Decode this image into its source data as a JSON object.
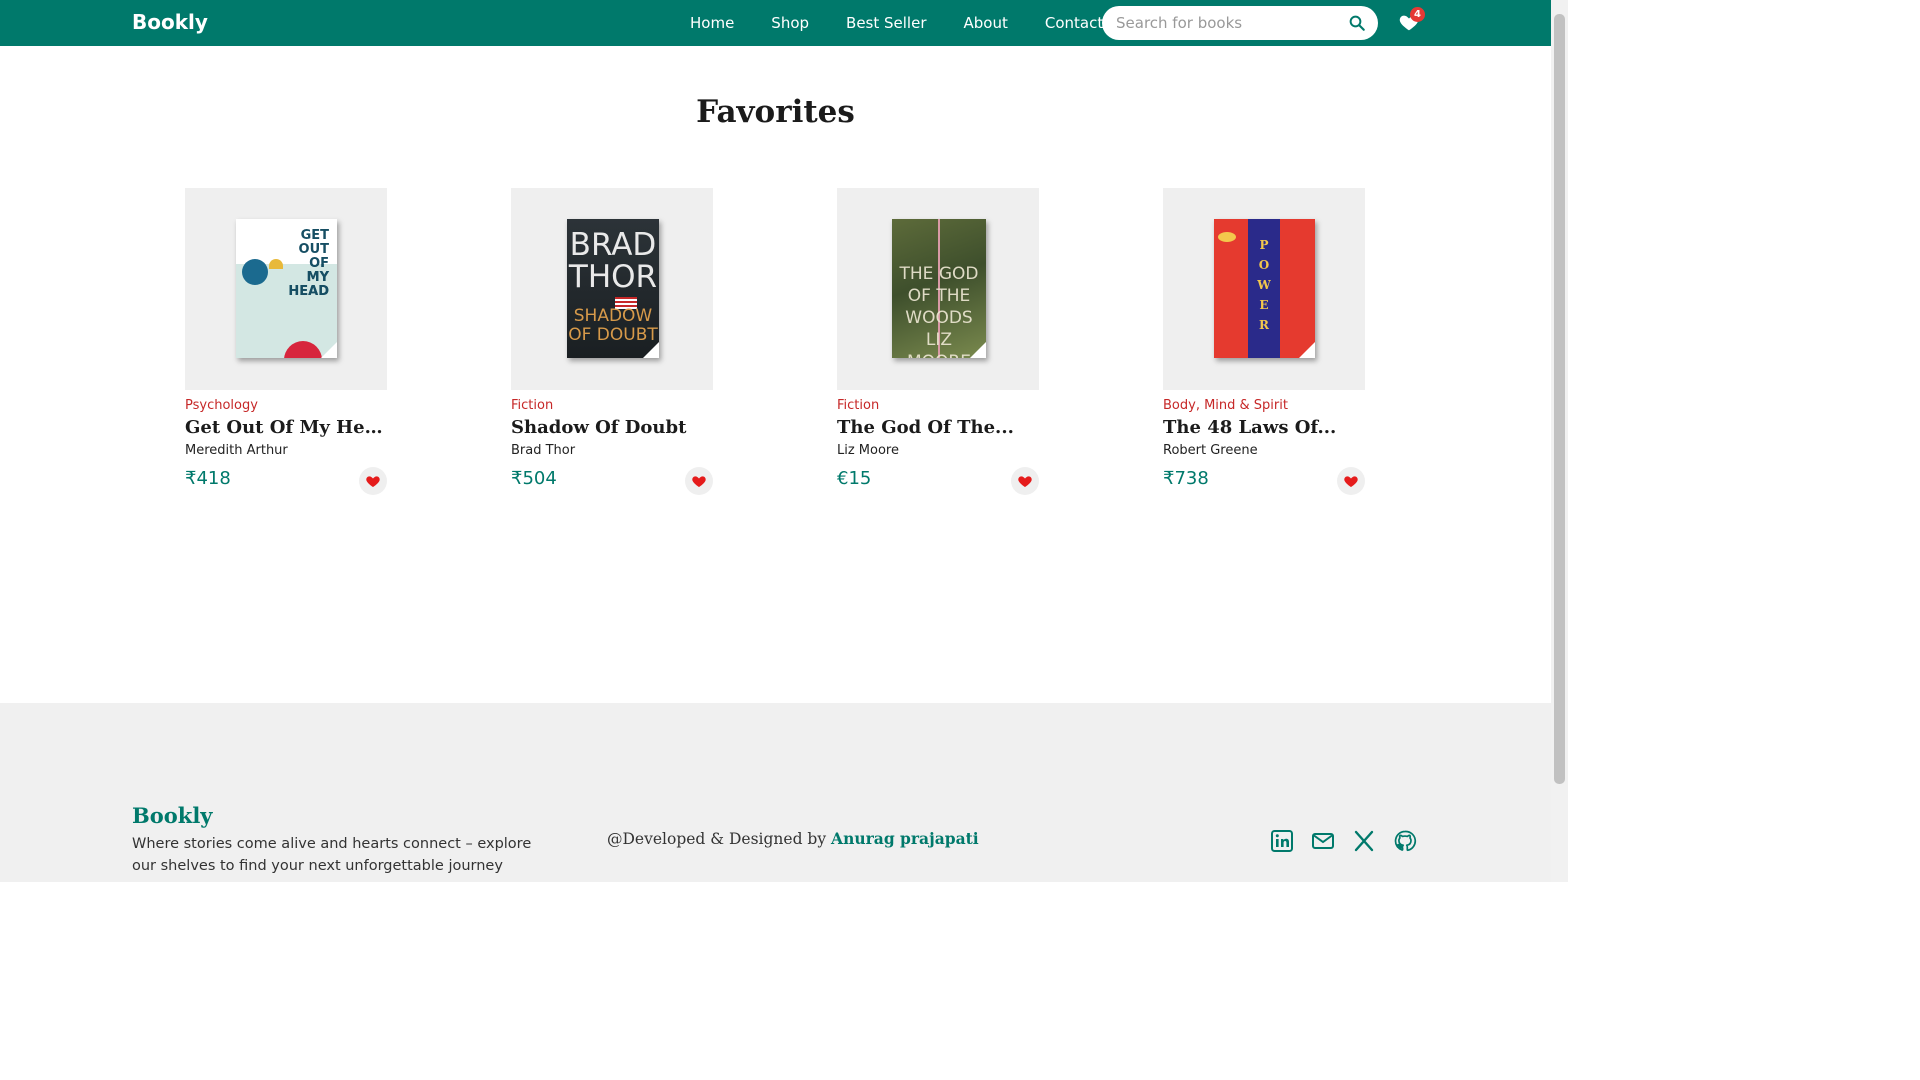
{
  "nav": {
    "brand": "Bookly",
    "links": [
      "Home",
      "Shop",
      "Best Seller",
      "About",
      "Contact"
    ],
    "search_placeholder": "Search for books",
    "favorites_count": "4"
  },
  "page": {
    "title": "Favorites"
  },
  "books": [
    {
      "category": "Psychology",
      "title": "Get Out Of My Head",
      "author": "Meredith Arthur",
      "price": "₹418",
      "cover_text": [
        "GET",
        "OUT",
        "OF",
        "MY",
        "HEAD"
      ]
    },
    {
      "category": "Fiction",
      "title": "Shadow Of Doubt",
      "author": "Brad Thor",
      "price": "₹504",
      "cover_text": [
        "BRAD",
        "THOR",
        "SHADOW",
        "OF DOUBT"
      ]
    },
    {
      "category": "Fiction",
      "title": "The God Of The...",
      "author": "Liz Moore",
      "price": "€15",
      "cover_text": [
        "THE GOD",
        "OF THE",
        "WOODS",
        "LIZ MOORE"
      ]
    },
    {
      "category": "Body, Mind & Spirit",
      "title": "The 48 Laws Of...",
      "author": "Robert Greene",
      "price": "₹738",
      "cover_text": [
        "P",
        "O",
        "W",
        "E",
        "R"
      ]
    }
  ],
  "footer": {
    "brand": "Bookly",
    "tagline": "Where stories come alive and hearts connect – explore our shelves to find your next unforgettable journey",
    "credit_prefix": "@Developed & Designed by",
    "credit_name": "Anurag prajapati"
  },
  "colors": {
    "primary": "#00796b",
    "category": "#c62828",
    "heart": "#e51b1b"
  },
  "icons": [
    "search-icon",
    "heart-icon",
    "linkedin-icon",
    "mail-icon",
    "x-icon",
    "github-icon"
  ]
}
